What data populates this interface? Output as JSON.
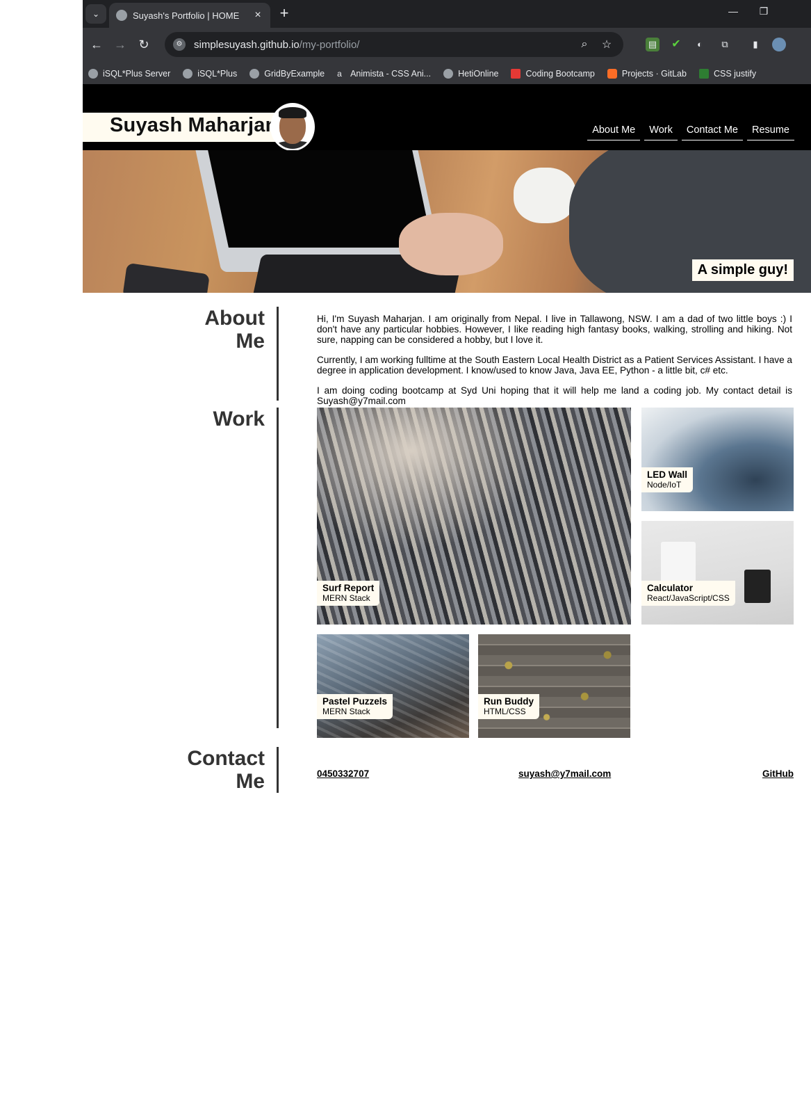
{
  "browser": {
    "tab_title": "Suyash's Portfolio | HOME",
    "url_host": "simplesuyash.github.io",
    "url_path": "/my-portfolio/",
    "bookmarks": [
      {
        "label": "iSQL*Plus Server"
      },
      {
        "label": "iSQL*Plus"
      },
      {
        "label": "GridByExample"
      },
      {
        "label": "Animista - CSS Ani..."
      },
      {
        "label": "HetiOnline"
      },
      {
        "label": "Coding Bootcamp"
      },
      {
        "label": "Projects · GitLab"
      },
      {
        "label": "CSS justify"
      }
    ]
  },
  "header": {
    "name": "Suyash Maharjan",
    "nav": [
      "About Me",
      "Work",
      "Contact Me",
      "Resume"
    ],
    "hero_tag": "A simple guy!"
  },
  "about": {
    "title_line1": "About",
    "title_line2": "Me",
    "paragraphs": [
      "Hi, I'm Suyash Maharjan. I am originally from Nepal. I live in Tallawong, NSW. I am a dad of two little boys :) I don't have any particular hobbies. However, I like reading high fantasy books, walking, strolling and hiking. Not sure, napping can be considered a hobby, but I love it.",
      "Currently, I am working fulltime at the South Eastern Local Health District as a Patient Services Assistant. I have a degree in application development. I know/used to know Java, Java EE, Python - a little bit, c# etc.",
      "I am doing coding bootcamp at Syd Uni hoping that it will help me land a coding job. My contact detail is Suyash@y7mail.com"
    ]
  },
  "work": {
    "title": "Work",
    "projects": [
      {
        "name": "Surf Report",
        "tech": "MERN Stack"
      },
      {
        "name": "LED Wall",
        "tech": "Node/IoT"
      },
      {
        "name": "Calculator",
        "tech": "React/JavaScript/CSS"
      },
      {
        "name": "Pastel Puzzels",
        "tech": "MERN Stack"
      },
      {
        "name": "Run Buddy",
        "tech": "HTML/CSS"
      }
    ]
  },
  "contact": {
    "title_line1": "Contact",
    "title_line2": "Me",
    "phone": "0450332707",
    "email": "suyash@y7mail.com",
    "github": "GitHub"
  }
}
